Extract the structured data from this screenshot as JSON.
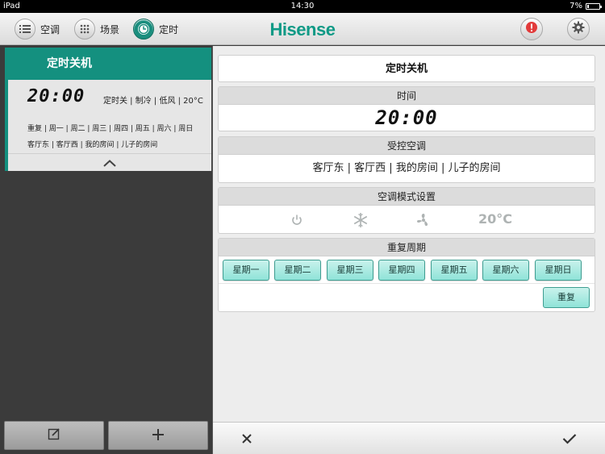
{
  "status_bar": {
    "device": "iPad",
    "time": "14:30",
    "battery": "7%"
  },
  "nav": {
    "items": [
      {
        "label": "空调",
        "icon": "list-icon"
      },
      {
        "label": "场景",
        "icon": "grid-icon"
      },
      {
        "label": "定时",
        "icon": "clock-icon"
      }
    ],
    "brand": "Hisense",
    "alert_icon": "alert-icon",
    "settings_icon": "gear-icon"
  },
  "timer_card": {
    "title": "定时关机",
    "time": "20:00",
    "summary": "定时关 | 制冷 | 低风 | 20°C",
    "repeat_line": "重复 | 周一 | 周二 | 周三 | 周四 | 周五 | 周六 | 周日",
    "rooms_line": "客厅东 | 客厅西 | 我的房间 | 儿子的房间"
  },
  "detail": {
    "title": "定时关机",
    "time_label": "时间",
    "time_value": "20:00",
    "ac_label": "受控空调",
    "ac_value": "客厅东 | 客厅西 | 我的房间 | 儿子的房间",
    "mode_label": "空调模式设置",
    "mode_icons": [
      "power-icon",
      "snowflake-icon",
      "fan-icon"
    ],
    "mode_temp": "20°C",
    "repeat_label": "重复周期",
    "days": [
      "星期一",
      "星期二",
      "星期三",
      "星期四",
      "星期五",
      "星期六",
      "星期日"
    ],
    "repeat_button": "重复"
  },
  "colors": {
    "accent": "#14907f",
    "day_button": "#8fe3d8",
    "brand": "#0f9a86"
  }
}
